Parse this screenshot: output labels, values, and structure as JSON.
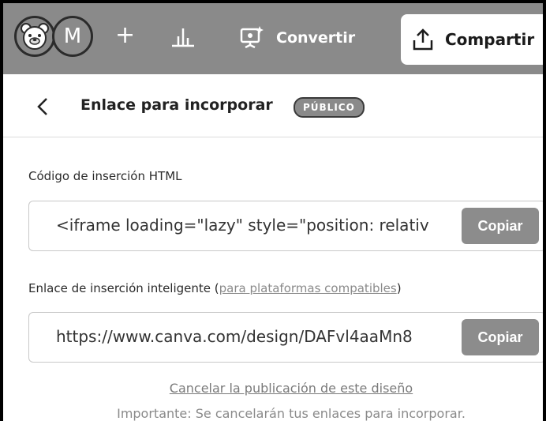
{
  "topbar": {
    "user_initial": "M",
    "add_icon": "plus-icon",
    "stats_icon": "stats-chart-icon",
    "convert_label": "Convertir",
    "share_label": "Compartir",
    "colors": {
      "bar_bg": "#8a8a8a",
      "share_bg": "#ffffff"
    }
  },
  "header": {
    "title": "Enlace para incorporar",
    "badge": "PÚBLICO"
  },
  "html_embed": {
    "label": "Código de inserción HTML",
    "value": "<iframe loading=\"lazy\" style=\"position: relativ",
    "copy_label": "Copiar"
  },
  "smart_embed": {
    "label_prefix": "Enlace de inserción inteligente (",
    "label_link": "para plataformas compatibles",
    "label_suffix": ")",
    "value": "https://www.canva.com/design/DAFvl4aaMn8",
    "copy_label": "Copiar"
  },
  "footer": {
    "unpublish_link": "Cancelar la publicación de este diseño",
    "warning": "Importante: Se cancelarán tus enlaces para incorporar."
  }
}
